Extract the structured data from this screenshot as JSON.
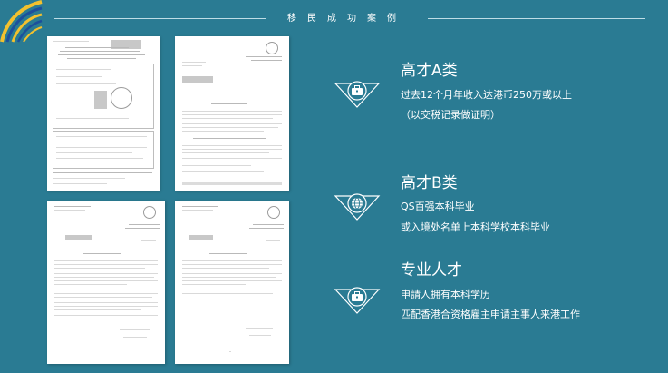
{
  "header": {
    "title": "移民成功案例"
  },
  "documents": [
    {
      "id": "doc1"
    },
    {
      "id": "doc2"
    },
    {
      "id": "doc3"
    },
    {
      "id": "doc4"
    }
  ],
  "categories": [
    {
      "icon": "briefcase-shield-icon",
      "title": "高才A类",
      "lines": [
        "过去12个月年收入达港币250万或以上",
        "（以交税记录做证明）"
      ]
    },
    {
      "icon": "globe-shield-icon",
      "title": "高才B类",
      "lines": [
        "QS百强本科毕业",
        "或入境处名单上本科学校本科毕业"
      ]
    },
    {
      "icon": "briefcase-shield-icon",
      "title": "专业人才",
      "lines": [
        "申請人拥有本科学历",
        "匹配香港合资格雇主申请主事人来港工作"
      ]
    }
  ],
  "colors": {
    "background": "#2a7b93",
    "logo_yellow": "#f2c12e",
    "logo_blue": "#1c4f9c"
  }
}
